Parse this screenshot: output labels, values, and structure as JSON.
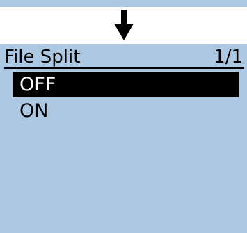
{
  "screen": {
    "title": "File Split",
    "page_indicator": "1/1",
    "selected_index": 0,
    "items": [
      {
        "label": "OFF"
      },
      {
        "label": "ON"
      }
    ]
  },
  "colors": {
    "lcd_background": "#adc8e2",
    "selection_background": "#000000",
    "selection_text": "#ffffff",
    "text": "#000000"
  },
  "icons": {
    "transition_arrow": "arrow-down-icon"
  }
}
